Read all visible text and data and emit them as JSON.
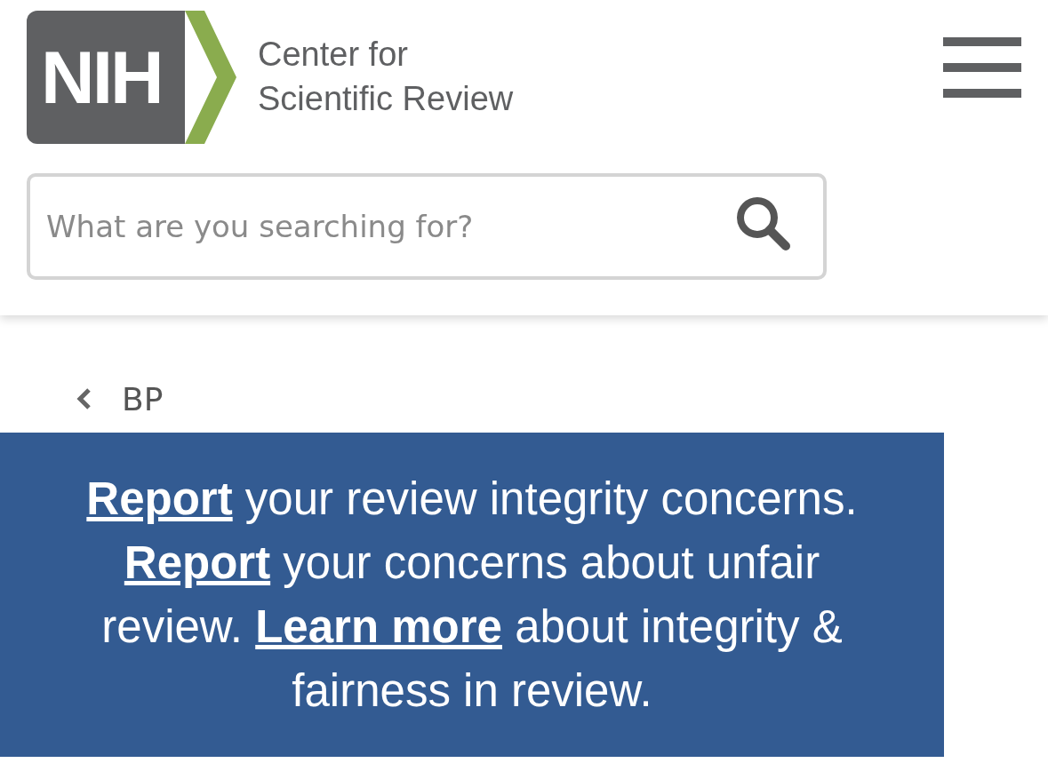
{
  "logo": {
    "mark": "NIH",
    "title_lines": [
      "Center for",
      "Scientific Review"
    ]
  },
  "search": {
    "placeholder": "What are you searching for?"
  },
  "breadcrumb": {
    "label": "BP"
  },
  "banner": {
    "segments": [
      {
        "kind": "link",
        "text": "Report"
      },
      {
        "kind": "text",
        "text": " your review integrity concerns. "
      },
      {
        "kind": "link",
        "text": "Report"
      },
      {
        "kind": "text",
        "text": " your concerns about unfair review. "
      },
      {
        "kind": "link",
        "text": "Learn more"
      },
      {
        "kind": "text",
        "text": " about integrity & fairness in review."
      }
    ]
  }
}
